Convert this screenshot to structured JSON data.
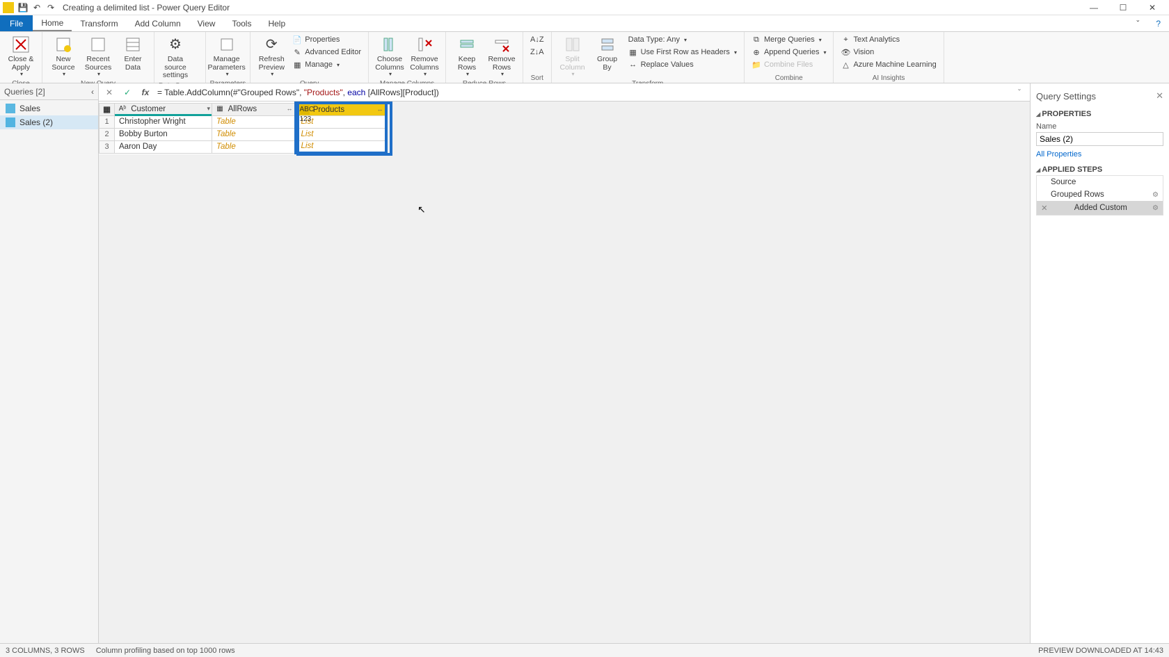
{
  "titlebar": {
    "title": "Creating a delimited list - Power Query Editor"
  },
  "tabs": {
    "file": "File",
    "home": "Home",
    "transform": "Transform",
    "add_column": "Add Column",
    "view": "View",
    "tools": "Tools",
    "help": "Help"
  },
  "ribbon": {
    "close_apply": "Close & Apply",
    "close_group": "Close",
    "new_source": "New Source",
    "recent_sources": "Recent Sources",
    "enter_data": "Enter Data",
    "new_query_group": "New Query",
    "data_source_settings": "Data source settings",
    "data_sources_group": "Data Sources",
    "manage_parameters": "Manage Parameters",
    "parameters_group": "Parameters",
    "refresh_preview": "Refresh Preview",
    "properties": "Properties",
    "advanced_editor": "Advanced Editor",
    "manage": "Manage",
    "query_group": "Query",
    "choose_columns": "Choose Columns",
    "remove_columns": "Remove Columns",
    "manage_columns_group": "Manage Columns",
    "keep_rows": "Keep Rows",
    "remove_rows": "Remove Rows",
    "reduce_rows_group": "Reduce Rows",
    "sort_group": "Sort",
    "split_column": "Split Column",
    "group_by": "Group By",
    "data_type": "Data Type: Any",
    "first_row_headers": "Use First Row as Headers",
    "replace_values": "Replace Values",
    "transform_group": "Transform",
    "merge_queries": "Merge Queries",
    "append_queries": "Append Queries",
    "combine_files": "Combine Files",
    "combine_group": "Combine",
    "text_analytics": "Text Analytics",
    "vision": "Vision",
    "azure_ml": "Azure Machine Learning",
    "ai_insights_group": "AI Insights"
  },
  "queries_pane": {
    "header": "Queries [2]",
    "items": [
      "Sales",
      "Sales (2)"
    ]
  },
  "formula": {
    "prefix": "= Table.AddColumn(#\"Grouped Rows\", ",
    "str": "\"Products\"",
    "mid": ", ",
    "each": "each",
    "suffix": " [AllRows][Product])"
  },
  "grid": {
    "columns": [
      "Customer",
      "AllRows",
      "Products"
    ],
    "rows": [
      {
        "n": "1",
        "customer": "Christopher Wright",
        "allrows": "Table",
        "products": "List"
      },
      {
        "n": "2",
        "customer": "Bobby Burton",
        "allrows": "Table",
        "products": "List"
      },
      {
        "n": "3",
        "customer": "Aaron Day",
        "allrows": "Table",
        "products": "List"
      }
    ]
  },
  "settings": {
    "title": "Query Settings",
    "properties": "PROPERTIES",
    "name_label": "Name",
    "name_value": "Sales (2)",
    "all_properties": "All Properties",
    "applied_steps": "APPLIED STEPS",
    "steps": [
      "Source",
      "Grouped Rows",
      "Added Custom"
    ]
  },
  "statusbar": {
    "left": "3 COLUMNS, 3 ROWS",
    "mid": "Column profiling based on top 1000 rows",
    "right": "PREVIEW DOWNLOADED AT 14:43"
  }
}
